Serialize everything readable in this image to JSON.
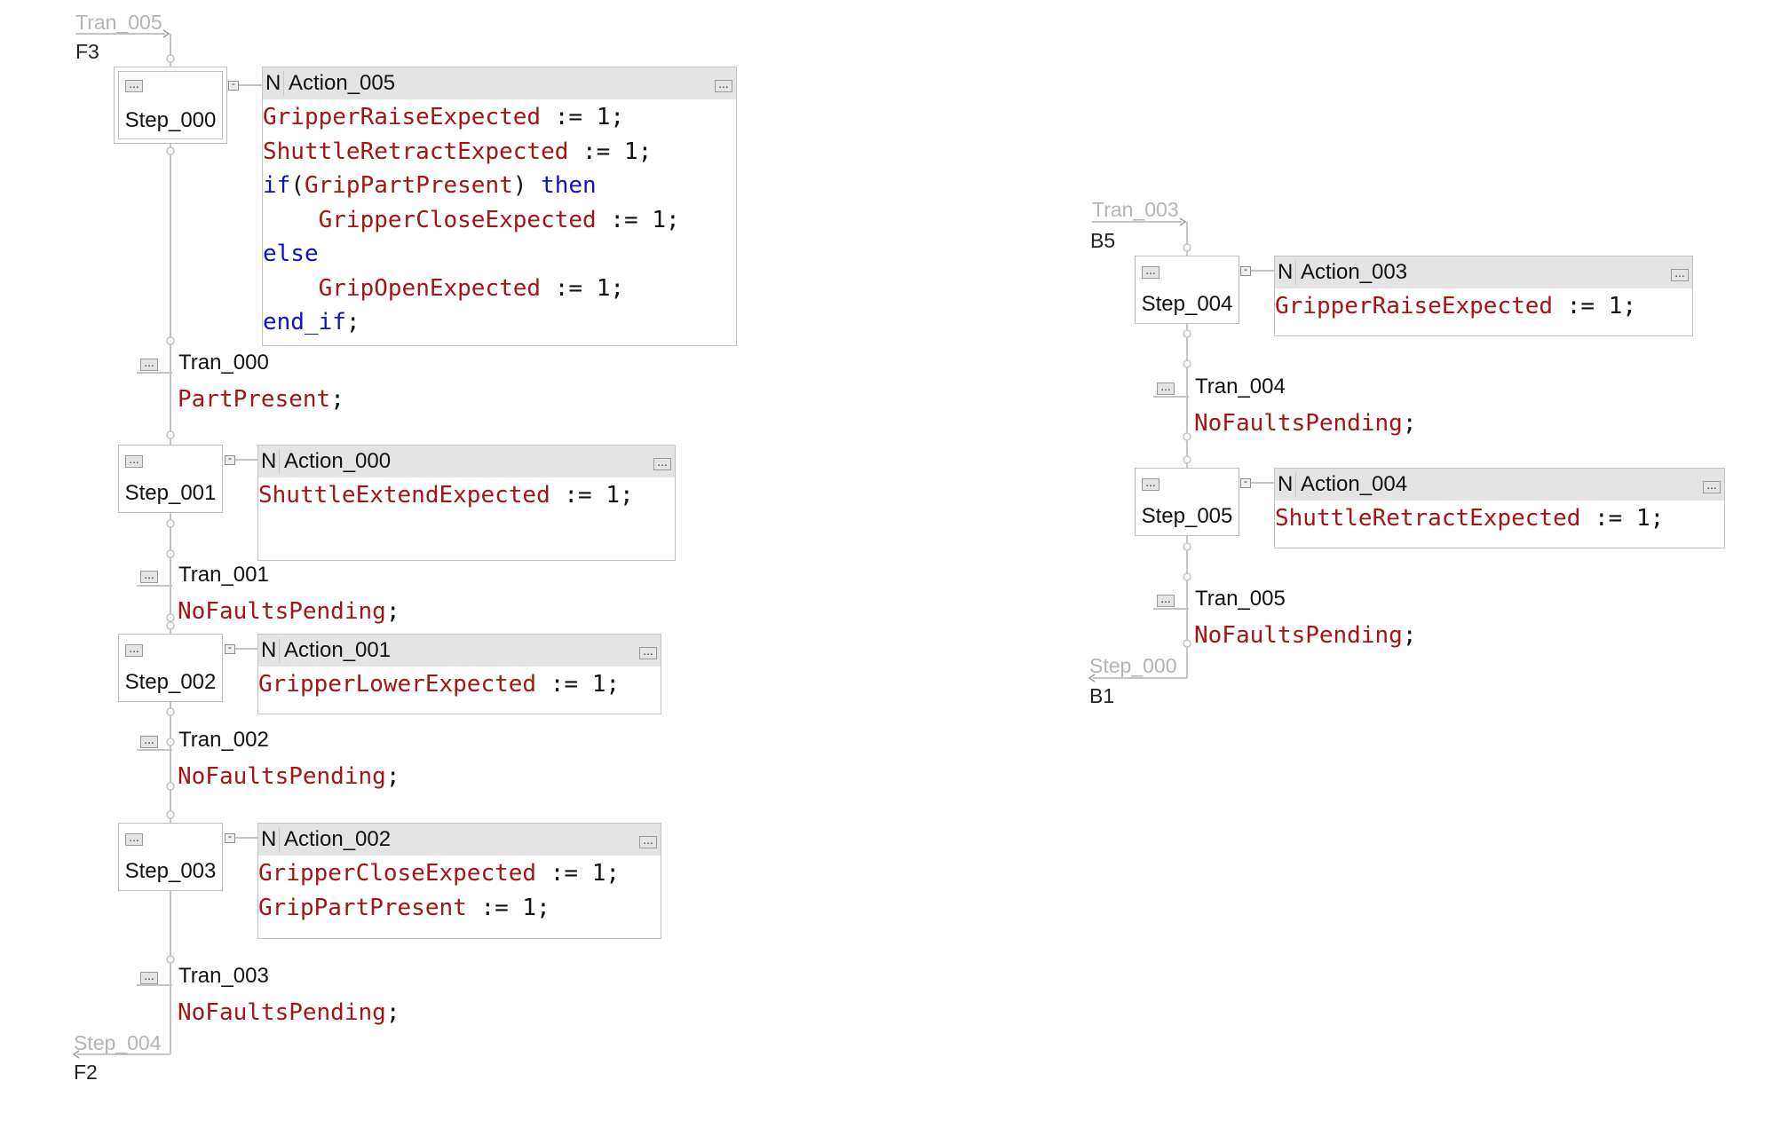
{
  "colors": {
    "identifier": "#a31515",
    "keyword": "#1010c8",
    "operator": "#111111",
    "connector_line": "#c4c4c4",
    "header_bg": "#e4e4e4",
    "reference_gray": "#b4b4b4"
  },
  "icons": {
    "ellipsis": "...",
    "collapse": "-"
  },
  "chains": [
    {
      "in_ref": {
        "name": "Tran_005",
        "grid": "F3"
      },
      "out_ref": {
        "name": "Step_004",
        "grid": "F2"
      },
      "steps": [
        {
          "name": "Step_000",
          "initial": true,
          "action": {
            "qualifier": "N",
            "name": "Action_005",
            "lines": [
              [
                {
                  "t": "GripperRaiseExpected",
                  "c": "id"
                },
                {
                  "t": " := 1;",
                  "c": "op"
                }
              ],
              [
                {
                  "t": "ShuttleRetractExpected",
                  "c": "id"
                },
                {
                  "t": " := 1;",
                  "c": "op"
                }
              ],
              [
                {
                  "t": "if",
                  "c": "kw"
                },
                {
                  "t": "(",
                  "c": "op"
                },
                {
                  "t": "GripPartPresent",
                  "c": "id"
                },
                {
                  "t": ") ",
                  "c": "op"
                },
                {
                  "t": "then",
                  "c": "kw"
                }
              ],
              [
                {
                  "t": "    ",
                  "c": "op"
                },
                {
                  "t": "GripperCloseExpected",
                  "c": "id"
                },
                {
                  "t": " := 1;",
                  "c": "op"
                }
              ],
              [
                {
                  "t": "else",
                  "c": "kw"
                }
              ],
              [
                {
                  "t": "    ",
                  "c": "op"
                },
                {
                  "t": "GripOpenExpected",
                  "c": "id"
                },
                {
                  "t": " := 1;",
                  "c": "op"
                }
              ],
              [
                {
                  "t": "end_if",
                  "c": "kw"
                },
                {
                  "t": ";",
                  "c": "op"
                }
              ]
            ]
          }
        },
        {
          "name": "Step_001",
          "initial": false,
          "action": {
            "qualifier": "N",
            "name": "Action_000",
            "lines": [
              [
                {
                  "t": "ShuttleExtendExpected",
                  "c": "id"
                },
                {
                  "t": " := 1;",
                  "c": "op"
                }
              ]
            ]
          }
        },
        {
          "name": "Step_002",
          "initial": false,
          "action": {
            "qualifier": "N",
            "name": "Action_001",
            "lines": [
              [
                {
                  "t": "GripperLowerExpected",
                  "c": "id"
                },
                {
                  "t": " := 1;",
                  "c": "op"
                }
              ]
            ]
          }
        },
        {
          "name": "Step_003",
          "initial": false,
          "action": {
            "qualifier": "N",
            "name": "Action_002",
            "lines": [
              [
                {
                  "t": "GripperCloseExpected",
                  "c": "id"
                },
                {
                  "t": " := 1;",
                  "c": "op"
                }
              ],
              [
                {
                  "t": "GripPartPresent",
                  "c": "id"
                },
                {
                  "t": " := 1;",
                  "c": "op"
                }
              ]
            ]
          }
        }
      ],
      "transitions": [
        {
          "name": "Tran_000",
          "condition": "PartPresent"
        },
        {
          "name": "Tran_001",
          "condition": "NoFaultsPending"
        },
        {
          "name": "Tran_002",
          "condition": "NoFaultsPending"
        },
        {
          "name": "Tran_003",
          "condition": "NoFaultsPending"
        }
      ]
    },
    {
      "in_ref": {
        "name": "Tran_003",
        "grid": "B5"
      },
      "out_ref": {
        "name": "Step_000",
        "grid": "B1"
      },
      "steps": [
        {
          "name": "Step_004",
          "initial": false,
          "action": {
            "qualifier": "N",
            "name": "Action_003",
            "lines": [
              [
                {
                  "t": "GripperRaiseExpected",
                  "c": "id"
                },
                {
                  "t": " := 1;",
                  "c": "op"
                }
              ]
            ]
          }
        },
        {
          "name": "Step_005",
          "initial": false,
          "action": {
            "qualifier": "N",
            "name": "Action_004",
            "lines": [
              [
                {
                  "t": "ShuttleRetractExpected",
                  "c": "id"
                },
                {
                  "t": " := 1;",
                  "c": "op"
                }
              ]
            ]
          }
        }
      ],
      "transitions": [
        {
          "name": "Tran_004",
          "condition": "NoFaultsPending"
        },
        {
          "name": "Tran_005",
          "condition": "NoFaultsPending"
        }
      ]
    }
  ]
}
